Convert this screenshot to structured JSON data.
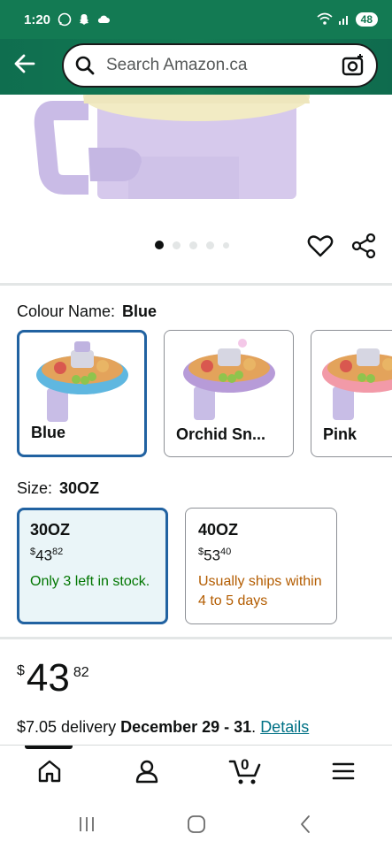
{
  "status_bar": {
    "time": "1:20",
    "battery": "48",
    "icons": [
      "whatsapp-icon",
      "snapchat-icon",
      "cloud-icon",
      "wifi-icon",
      "signal-icon"
    ]
  },
  "search": {
    "placeholder": "Search Amazon.ca"
  },
  "gallery": {
    "dot_count": 5,
    "active_dot": 0
  },
  "colour": {
    "label": "Colour Name:",
    "selected": "Blue",
    "options": [
      {
        "name": "Blue",
        "accent": "#5fb7e0"
      },
      {
        "name": "Orchid Sn...",
        "accent": "#b79bd8"
      },
      {
        "name": "Pink",
        "accent": "#f29aa8"
      }
    ]
  },
  "size": {
    "label": "Size:",
    "selected": "30OZ",
    "options": [
      {
        "name": "30OZ",
        "price_whole": "43",
        "price_frac": "82",
        "currency": "$",
        "availability": "Only 3 left in stock."
      },
      {
        "name": "40OZ",
        "price_whole": "53",
        "price_frac": "40",
        "currency": "$",
        "availability": "Usually ships within 4 to 5 days"
      }
    ]
  },
  "price": {
    "currency": "$",
    "whole": "43",
    "frac": "82"
  },
  "delivery": {
    "prefix": "$7.05 delivery ",
    "dates": "December 29 - 31",
    "suffix": ". ",
    "link": "Details"
  },
  "bottom_nav": {
    "cart_count": "0",
    "items": [
      "home-icon",
      "account-icon",
      "cart-icon",
      "menu-icon"
    ]
  },
  "colors": {
    "header_green": "#137a53",
    "selected_border": "#2162a1",
    "in_stock_green": "#007600",
    "ships_orange": "#b35c00",
    "link": "#007185"
  }
}
